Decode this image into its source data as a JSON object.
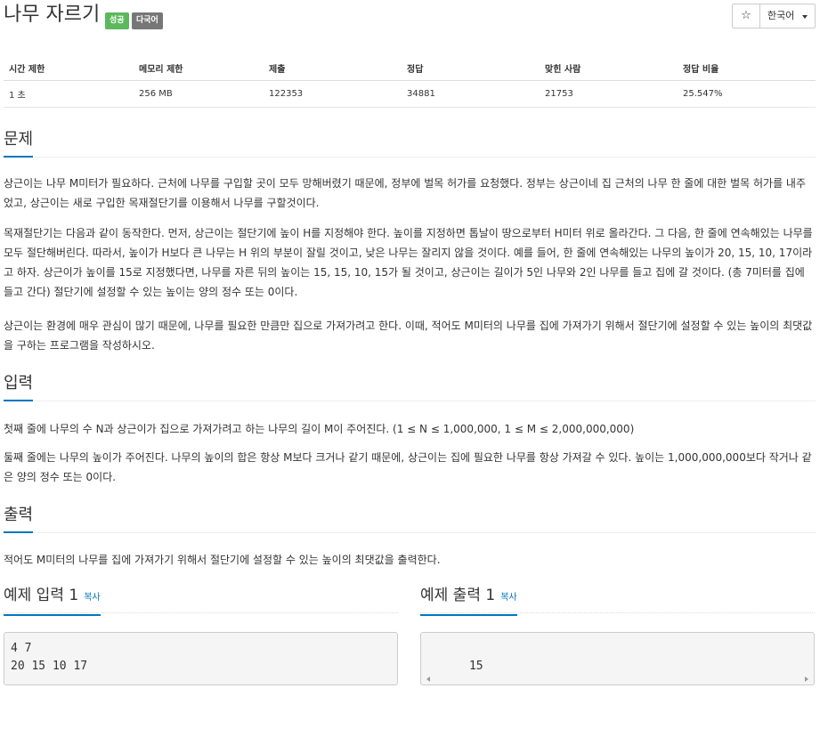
{
  "header": {
    "title": "나무 자르기",
    "badge_success": "성공",
    "badge_lang": "다국어",
    "star_icon": "☆",
    "language": "한국어"
  },
  "info": {
    "headers": [
      "시간 제한",
      "메모리 제한",
      "제출",
      "정답",
      "맞힌 사람",
      "정답 비율"
    ],
    "values": [
      "1 초",
      "256 MB",
      "122353",
      "34881",
      "21753",
      "25.547%"
    ]
  },
  "problem": {
    "heading": "문제",
    "p1": "상근이는 나무 M미터가 필요하다. 근처에 나무를 구입할 곳이 모두 망해버렸기 때문에, 정부에 벌목 허가를 요청했다. 정부는 상근이네 집 근처의 나무 한 줄에 대한 벌목 허가를 내주었고, 상근이는 새로 구입한 목재절단기를 이용해서 나무를 구할것이다.",
    "p2": "목재절단기는 다음과 같이 동작한다. 먼저, 상근이는 절단기에 높이 H를 지정해야 한다. 높이를 지정하면 톱날이 땅으로부터 H미터 위로 올라간다. 그 다음, 한 줄에 연속해있는 나무를 모두 절단해버린다. 따라서, 높이가 H보다 큰 나무는 H 위의 부분이 잘릴 것이고, 낮은 나무는 잘리지 않을 것이다. 예를 들어, 한 줄에 연속해있는 나무의 높이가 20, 15, 10, 17이라고 하자. 상근이가 높이를 15로 지정했다면, 나무를 자른 뒤의 높이는 15, 15, 10, 15가 될 것이고, 상근이는 길이가 5인 나무와 2인 나무를 들고 집에 갈 것이다. (총 7미터를 집에 들고 간다) 절단기에 설정할 수 있는 높이는 양의 정수 또는 0이다.",
    "p3": "상근이는 환경에 매우 관심이 많기 때문에, 나무를 필요한 만큼만 집으로 가져가려고 한다. 이때, 적어도 M미터의 나무를 집에 가져가기 위해서 절단기에 설정할 수 있는 높이의 최댓값을 구하는 프로그램을 작성하시오."
  },
  "input": {
    "heading": "입력",
    "p1": "첫째 줄에 나무의 수 N과 상근이가 집으로 가져가려고 하는 나무의 길이 M이 주어진다. (1 ≤ N ≤ 1,000,000, 1 ≤ M ≤ 2,000,000,000)",
    "p2": "둘째 줄에는 나무의 높이가 주어진다. 나무의 높이의 합은 항상 M보다 크거나 같기 때문에, 상근이는 집에 필요한 나무를 항상 가져갈 수 있다. 높이는 1,000,000,000보다 작거나 같은 양의 정수 또는 0이다."
  },
  "output": {
    "heading": "출력",
    "p1": "적어도 M미터의 나무를 집에 가져가기 위해서 절단기에 설정할 수 있는 높이의 최댓값을 출력한다."
  },
  "sample_input": {
    "heading": "예제 입력 1",
    "copy": "복사",
    "code": "4 7\n20 15 10 17"
  },
  "sample_output": {
    "heading": "예제 출력 1",
    "copy": "복사",
    "code": "15"
  }
}
